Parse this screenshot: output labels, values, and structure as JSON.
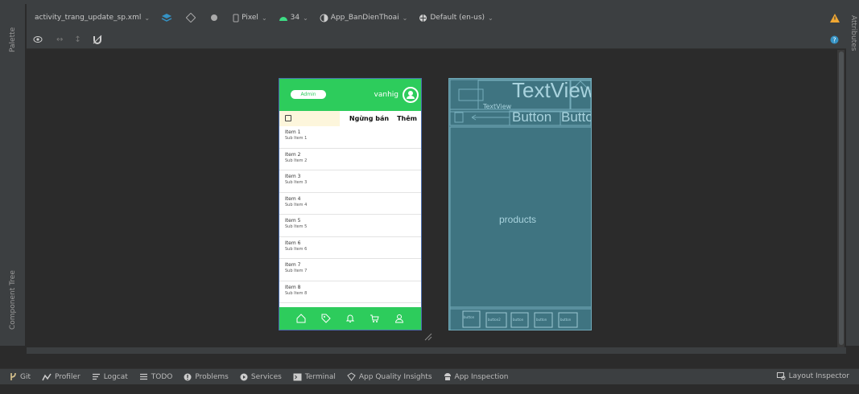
{
  "window": {
    "file_tab": "activity_trang_update_sp.xml"
  },
  "left_rail": {
    "palette": "Palette",
    "component_tree": "Component Tree"
  },
  "right_rail": {
    "attributes": "Attributes"
  },
  "toolbar": {
    "device": "Pixel",
    "api": "34",
    "theme": "App_BanDienThoai",
    "locale": "Default (en-us)"
  },
  "phone": {
    "admin": "Admin",
    "username": "vanhig",
    "btn_stop": "Ngừng bán",
    "btn_add": "Thêm",
    "items": [
      {
        "title": "Item 1",
        "sub": "Sub Item 1"
      },
      {
        "title": "Item 2",
        "sub": "Sub Item 2"
      },
      {
        "title": "Item 3",
        "sub": "Sub Item 3"
      },
      {
        "title": "Item 4",
        "sub": "Sub Item 4"
      },
      {
        "title": "Item 5",
        "sub": "Sub Item 5"
      },
      {
        "title": "Item 6",
        "sub": "Sub Item 6"
      },
      {
        "title": "Item 7",
        "sub": "Sub Item 7"
      },
      {
        "title": "Item 8",
        "sub": "Sub Item 8"
      }
    ],
    "nav": [
      "home-icon",
      "tag-icon",
      "bell-icon",
      "cart-icon",
      "user-icon"
    ]
  },
  "blueprint": {
    "textview": "TextView",
    "small": "TextView",
    "button1": "Button",
    "button2": "Button",
    "products": "products",
    "bottom_buttons": [
      "button",
      "button2",
      "button",
      "button",
      "button"
    ]
  },
  "bottom": {
    "items": [
      "Git",
      "Profiler",
      "Logcat",
      "TODO",
      "Problems",
      "Services",
      "Terminal",
      "App Quality Insights",
      "App Inspection"
    ],
    "right": "Layout Inspector"
  },
  "colors": {
    "accent_green": "#2dcc5c",
    "ide_bg": "#2b2b2b",
    "panel": "#3c3f41",
    "blueprint": "#3f7481"
  }
}
